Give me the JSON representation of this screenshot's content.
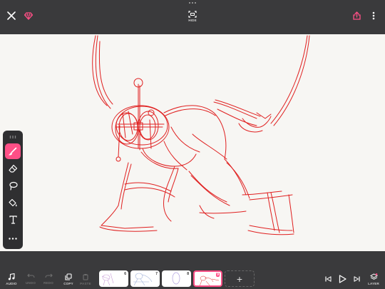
{
  "header": {
    "close_icon": "close-icon",
    "premium_icon": "diamond-icon",
    "hide_label": "HIDE",
    "share_icon": "share-icon",
    "more_icon": "vertical-dots-icon"
  },
  "tools": {
    "items": [
      "grip-handle",
      "brush",
      "eraser",
      "lasso",
      "fill-bucket",
      "text",
      "more"
    ],
    "active": "brush",
    "active_color": "#ff4f86"
  },
  "canvas": {
    "stroke_color": "#e02020",
    "paper_color": "#f7f6f3"
  },
  "bottom": {
    "audio_label": "AUDIO",
    "undo_label": "UNDO",
    "redo_label": "REDO",
    "copy_label": "COPY",
    "paste_label": "PASTE",
    "layer_label": "LAYER",
    "frames": [
      {
        "number": "6",
        "current": false
      },
      {
        "number": "7",
        "current": false
      },
      {
        "number": "8",
        "current": false
      },
      {
        "number": "9",
        "current": true
      }
    ],
    "add_frame_label": "+"
  }
}
